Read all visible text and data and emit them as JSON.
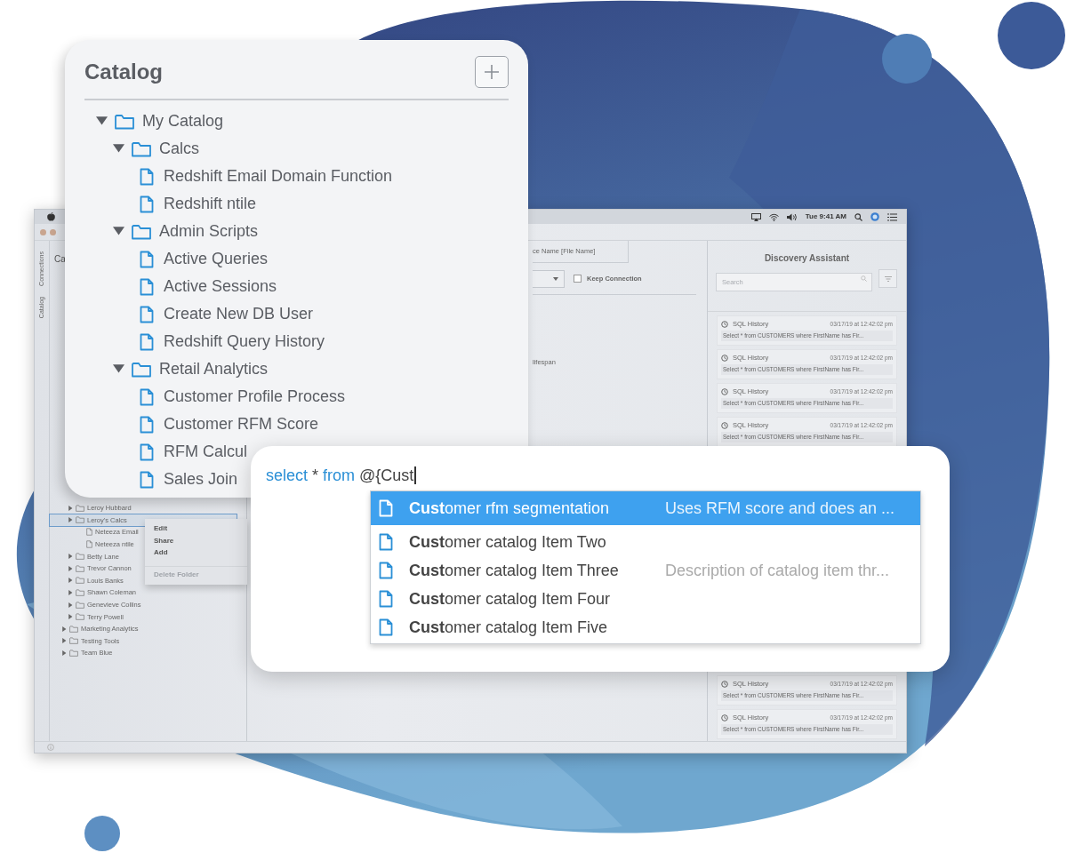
{
  "background_window": {
    "menu_bar": {
      "clock": "Tue 9:41 AM"
    },
    "side_tabs": [
      {
        "label": "Connections"
      },
      {
        "label": "Catalog"
      }
    ],
    "sidebar": {
      "title": "Ca",
      "tree": [
        {
          "children": [
            {
              "label": "Leroy Hubbard",
              "kind": "folder",
              "expanded": false,
              "selected": false
            },
            {
              "label": "Leroy's Calcs",
              "kind": "folder",
              "expanded": false,
              "selected": true,
              "children": [
                {
                  "label": "Neteeza Email",
                  "kind": "file",
                  "selected": false
                },
                {
                  "label": "Neteeza ntile",
                  "kind": "file",
                  "selected": false
                }
              ]
            },
            {
              "label": "Betty Lane",
              "kind": "folder",
              "expanded": false,
              "selected": false
            },
            {
              "label": "Trevor Cannon",
              "kind": "folder",
              "expanded": false,
              "selected": false
            },
            {
              "label": "Louis Banks",
              "kind": "folder",
              "expanded": false,
              "selected": false
            },
            {
              "label": "Shawn Coleman",
              "kind": "folder",
              "expanded": false,
              "selected": false
            },
            {
              "label": "Genevieve Collins",
              "kind": "folder",
              "expanded": false,
              "selected": false
            },
            {
              "label": "Terry Powell",
              "kind": "folder",
              "expanded": false,
              "selected": false
            }
          ]
        },
        {
          "label": "Marketing Analytics",
          "kind": "folder",
          "expanded": false,
          "selected": false
        },
        {
          "label": "Testing Tools",
          "kind": "folder",
          "expanded": false,
          "selected": false
        },
        {
          "label": "Team Blue",
          "kind": "folder",
          "expanded": false,
          "selected": false
        }
      ]
    },
    "context_menu": {
      "items": [
        {
          "label": "Edit",
          "disabled": false
        },
        {
          "label": "Share",
          "disabled": false
        },
        {
          "label": "Add",
          "disabled": false
        },
        {
          "label": "Delete Folder",
          "disabled": true
        }
      ]
    },
    "editor": {
      "tab": "ce Name [File Name]",
      "keep_connection": {
        "label": "Keep Connection",
        "checked": false
      },
      "text": "lifespan"
    },
    "discovery_assistant": {
      "title": "Discovery Assistant",
      "search": {
        "placeholder": "Search"
      },
      "history_top": [
        {
          "title": "SQL History",
          "time": "03/17/19 at 12:42:02 pm",
          "query": "Select * from CUSTOMERS where FirstName has Fir..."
        },
        {
          "title": "SQL History",
          "time": "03/17/19 at 12:42:02 pm",
          "query": "Select * from CUSTOMERS where FirstName has Fir..."
        },
        {
          "title": "SQL History",
          "time": "03/17/19 at 12:42:02 pm",
          "query": "Select * from CUSTOMERS where FirstName has Fir..."
        },
        {
          "title": "SQL History",
          "time": "03/17/19 at 12:42:02 pm",
          "query": "Select * from CUSTOMERS where FirstName has Fir..."
        }
      ],
      "history_bottom": [
        {
          "title": "SQL History",
          "time": "03/17/19 at 12:42:02 pm",
          "query": "Select * from CUSTOMERS where FirstName has Fir..."
        },
        {
          "title": "SQL History",
          "time": "03/17/19 at 12:42:02 pm",
          "query": "Select * from CUSTOMERS where FirstName has Fir..."
        }
      ]
    }
  },
  "catalog_panel": {
    "title": "Catalog",
    "tree": [
      {
        "label": "My Catalog",
        "kind": "folder",
        "expanded": true,
        "children": [
          {
            "label": "Calcs",
            "kind": "folder",
            "expanded": true,
            "children": [
              {
                "label": "Redshift Email Domain Function",
                "kind": "file"
              },
              {
                "label": "Redshift ntile",
                "kind": "file"
              }
            ]
          },
          {
            "label": "Admin Scripts",
            "kind": "folder",
            "expanded": true,
            "children": [
              {
                "label": "Active Queries",
                "kind": "file"
              },
              {
                "label": "Active Sessions",
                "kind": "file"
              },
              {
                "label": "Create New DB User",
                "kind": "file"
              },
              {
                "label": "Redshift Query History",
                "kind": "file"
              }
            ]
          },
          {
            "label": "Retail Analytics",
            "kind": "folder",
            "expanded": true,
            "children": [
              {
                "label": "Customer Profile Process",
                "kind": "file"
              },
              {
                "label": "Customer RFM Score",
                "kind": "file"
              },
              {
                "label": "RFM Calcul",
                "kind": "file"
              },
              {
                "label": "Sales Join",
                "kind": "file"
              }
            ]
          }
        ]
      }
    ]
  },
  "autocomplete": {
    "query": [
      {
        "text": "select",
        "kind": "keyword"
      },
      {
        "text": "*",
        "kind": "plain"
      },
      {
        "text": "from",
        "kind": "keyword"
      },
      {
        "text": "@{Cust",
        "kind": "plain"
      }
    ],
    "suggestions": [
      {
        "name": "**Cust**omer rfm segmentation",
        "description": "Uses RFM score and does an ...",
        "selected": true
      },
      {
        "name": "**Cust**omer catalog Item Two",
        "selected": false
      },
      {
        "name": "**Cust**omer catalog Item Three",
        "description": "Description of catalog item thr...",
        "selected": false
      },
      {
        "name": "**Cust**omer catalog Item Four",
        "selected": false
      },
      {
        "name": "**Cust**omer catalog Item Five",
        "selected": false
      }
    ]
  }
}
